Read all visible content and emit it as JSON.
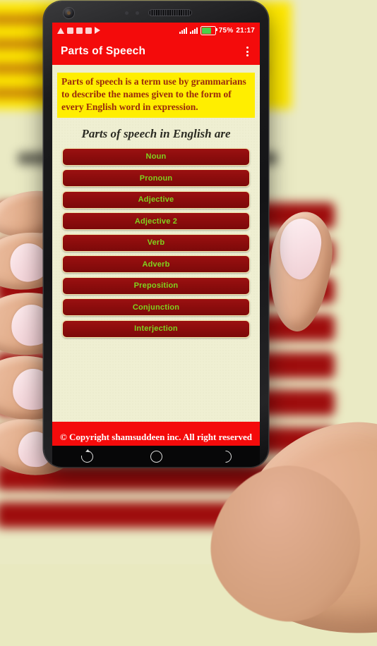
{
  "status_bar": {
    "notification_icons": [
      "warning-icon",
      "app-icon-1",
      "app-icon-2",
      "app-icon-3",
      "play-icon"
    ],
    "battery_percent": "75%",
    "time": "21:17",
    "signal_label": "",
    "accent_color": "#f40b0b"
  },
  "app_bar": {
    "title": "Parts of Speech",
    "overflow_label": "",
    "background_color": "#f40b0b"
  },
  "main": {
    "intro_text": "Parts of speech is a term use by grammarians to describe the names given to the form of every English word in expression.",
    "intro_background": "#ffee00",
    "intro_text_color": "#9a2b0c",
    "heading": "Parts of speech in English are",
    "button_background": "#8a0c0c",
    "button_border": "#f4e3a8",
    "button_text_color": "#7fd41f",
    "page_background": "#efefd2",
    "buttons": [
      {
        "label": "Noun"
      },
      {
        "label": "Pronoun"
      },
      {
        "label": "Adjective"
      },
      {
        "label": "Adjective 2"
      },
      {
        "label": "Verb"
      },
      {
        "label": "Adverb"
      },
      {
        "label": "Preposition"
      },
      {
        "label": "Conjunction"
      },
      {
        "label": "Interjection"
      }
    ]
  },
  "footer": {
    "copyright": "© Copyright shamsuddeen inc. All right reserved",
    "background_color": "#f40b0b"
  },
  "nav_bar": {
    "items": [
      {
        "name": "recent-apps"
      },
      {
        "name": "home"
      },
      {
        "name": "back"
      }
    ]
  }
}
